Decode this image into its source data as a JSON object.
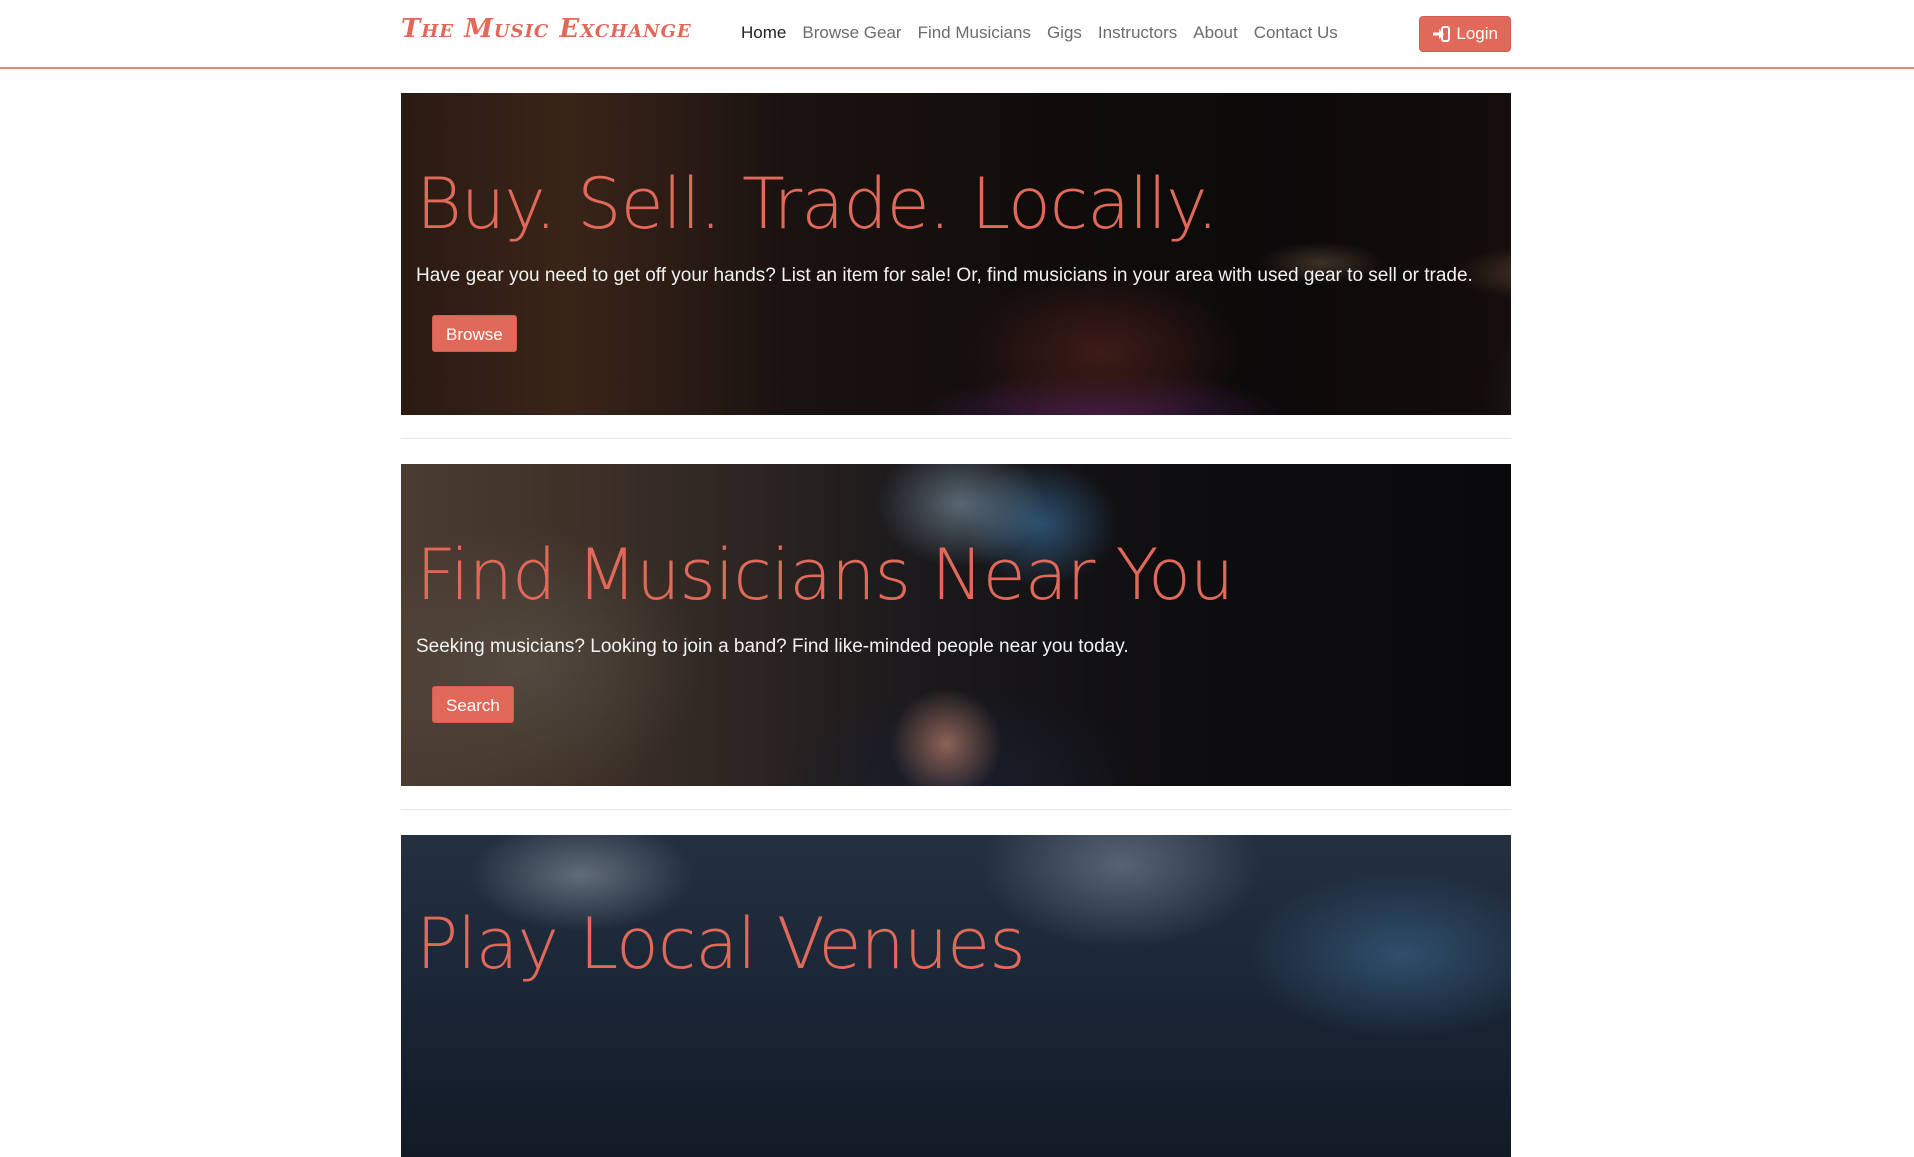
{
  "brand": {
    "name": "The Music Exchange"
  },
  "nav": {
    "items": [
      {
        "label": "Home"
      },
      {
        "label": "Browse Gear"
      },
      {
        "label": "Find Musicians"
      },
      {
        "label": "Gigs"
      },
      {
        "label": "Instructors"
      },
      {
        "label": "About"
      },
      {
        "label": "Contact Us"
      }
    ],
    "login_label": "Login",
    "login_icon": "sign-in-icon"
  },
  "sections": [
    {
      "title": "Buy. Sell. Trade. Locally.",
      "text": "Have gear you need to get off your hands? List an item for sale! Or, find musicians in your area with used gear to sell or trade.",
      "button": "Browse"
    },
    {
      "title": "Find Musicians Near You",
      "text": "Seeking musicians? Looking to join a band? Find like-minded people near you today.",
      "button": "Search"
    },
    {
      "title": "Play Local Venues"
    }
  ],
  "colors": {
    "accent": "#e0695a",
    "nav_text": "#6c6c6c",
    "nav_active": "#222222",
    "divider": "#e6e6e6"
  }
}
